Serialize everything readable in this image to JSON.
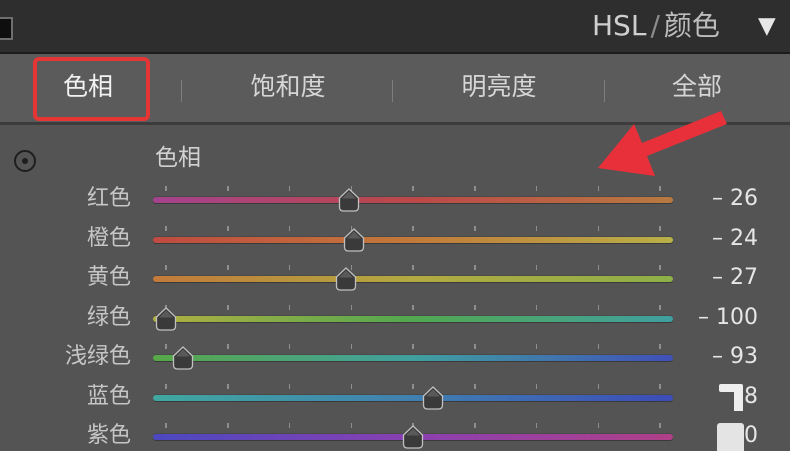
{
  "header": {
    "panel_toggle_icon": "panel-toggle-icon",
    "title_primary": "HSL",
    "title_separator": "/",
    "title_secondary": "颜色",
    "dropdown_glyph": "▼"
  },
  "tabs": [
    {
      "label": "色相",
      "active": true
    },
    {
      "label": "饱和度",
      "active": false
    },
    {
      "label": "明亮度",
      "active": false
    },
    {
      "label": "全部",
      "active": false
    }
  ],
  "hue": {
    "target_icon": "target-adjustment-icon",
    "heading": "色相",
    "range": [
      -100,
      100
    ],
    "rows": [
      {
        "label": "红色",
        "value": -26,
        "display": "– 26",
        "track_colors": [
          "#a4428e",
          "#bc4848",
          "#b87a40"
        ]
      },
      {
        "label": "橙色",
        "value": -24,
        "display": "– 24",
        "track_colors": [
          "#c04a40",
          "#c27a3a",
          "#b8b048"
        ]
      },
      {
        "label": "黄色",
        "value": -27,
        "display": "– 27",
        "track_colors": [
          "#c27a3a",
          "#b2aa40",
          "#8eb048"
        ]
      },
      {
        "label": "绿色",
        "value": -100,
        "display": "– 100",
        "track_colors": [
          "#b2b040",
          "#52a850",
          "#40a0a0"
        ]
      },
      {
        "label": "浅绿色",
        "value": -93,
        "display": "– 93",
        "track_colors": [
          "#58a848",
          "#40a0a0",
          "#4050b8"
        ]
      },
      {
        "label": "蓝色",
        "value": 8,
        "display": "8",
        "track_colors": [
          "#40a8a0",
          "#4080b0",
          "#3c4cb8"
        ]
      },
      {
        "label": "紫色",
        "value": 0,
        "display": "0",
        "track_colors": [
          "#4c48c0",
          "#8a40b0",
          "#b04088"
        ]
      }
    ]
  },
  "colors": {
    "tab_highlight": "#e53535",
    "annotation_arrow": "#e8303a",
    "thumb_fill": "#3a3a3a",
    "thumb_stroke": "#c0c0c0"
  }
}
